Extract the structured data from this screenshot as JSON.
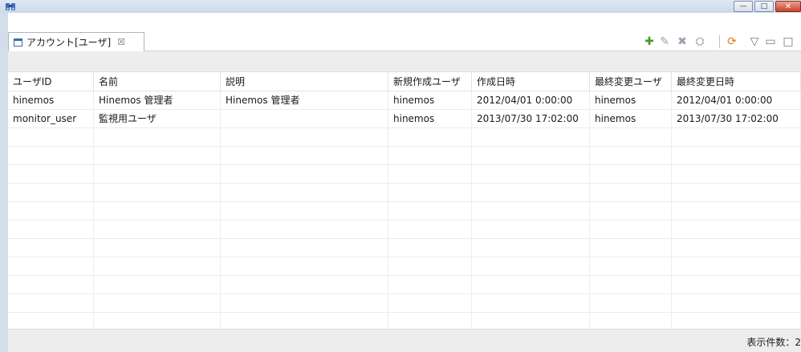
{
  "window": {
    "controls": {
      "minimize": "—",
      "maximize": "□",
      "close": "✕"
    }
  },
  "view": {
    "tab_label": "アカウント[ユーザ]",
    "tab_close_glyph": "☒"
  },
  "toolbar": {
    "icons": [
      {
        "name": "add-icon",
        "glyph": "✚",
        "color": "#4a9a2e"
      },
      {
        "name": "edit-icon",
        "glyph": "✎",
        "color": "#9aa4b0"
      },
      {
        "name": "delete-icon",
        "glyph": "✖",
        "color": "#9aa4b0"
      },
      {
        "name": "permission-icon",
        "glyph": "⛭",
        "color": "#9aa4b0"
      },
      {
        "name": "refresh-icon",
        "glyph": "⟳",
        "color": "#e07b18"
      },
      {
        "name": "view-menu-icon",
        "glyph": "▽",
        "color": "#6b7a8c"
      },
      {
        "name": "minimize-view-icon",
        "glyph": "▭",
        "color": "#6b7a8c"
      },
      {
        "name": "maximize-view-icon",
        "glyph": "□",
        "color": "#6b7a8c"
      }
    ]
  },
  "table": {
    "columns": [
      "ユーザID",
      "名前",
      "説明",
      "新規作成ユーザ",
      "作成日時",
      "最終変更ユーザ",
      "最終変更日時"
    ],
    "rows": [
      [
        "hinemos",
        "Hinemos 管理者",
        "Hinemos 管理者",
        "hinemos",
        "2012/04/01 0:00:00",
        "hinemos",
        "2012/04/01 0:00:00"
      ],
      [
        "monitor_user",
        "監視用ユーザ",
        "",
        "hinemos",
        "2013/07/30 17:02:00",
        "hinemos",
        "2013/07/30 17:02:00"
      ]
    ]
  },
  "status": {
    "count_text": "表示件数：2"
  }
}
